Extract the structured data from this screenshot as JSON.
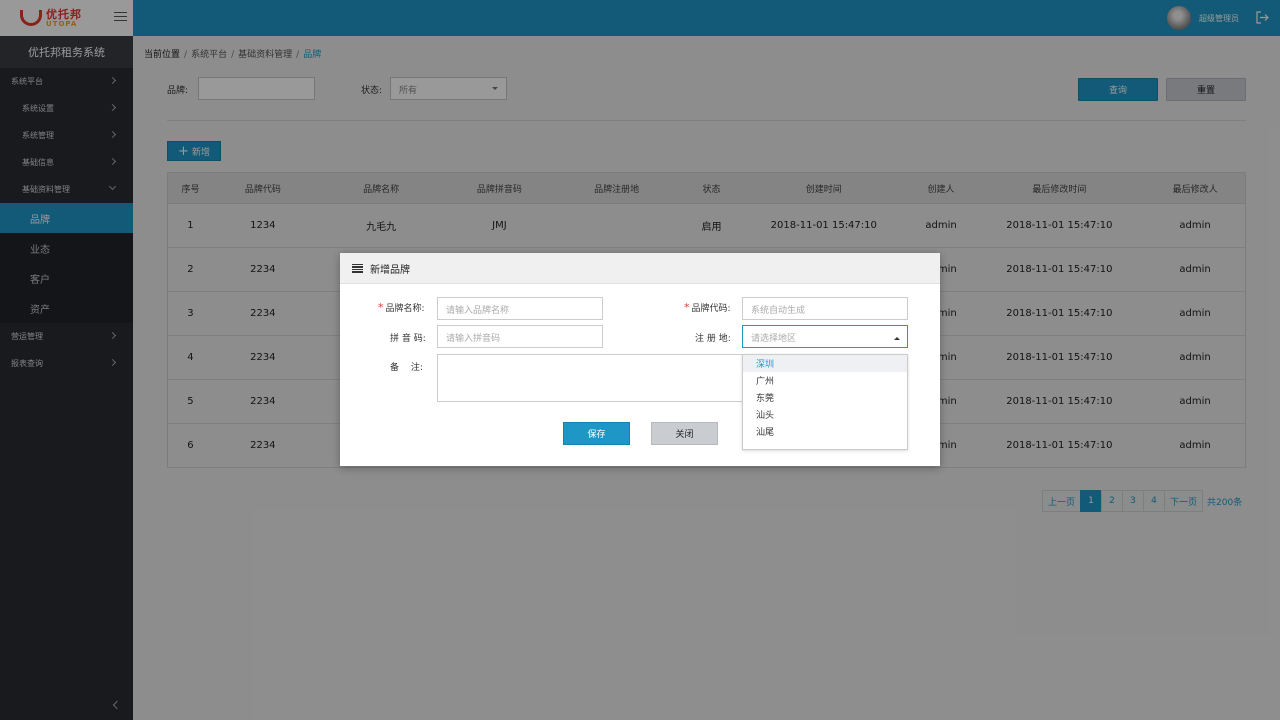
{
  "app": {
    "logo_cn": "优托邦",
    "logo_en": "UTOPA",
    "system_title": "优托邦租务系统",
    "admin_name": "超级管理员"
  },
  "sidebar": {
    "items": [
      {
        "label": "系统平台"
      },
      {
        "label": "系统设置"
      },
      {
        "label": "系统管理"
      },
      {
        "label": "基础信息"
      },
      {
        "label": "基础资料管理"
      },
      {
        "label": "品牌"
      },
      {
        "label": "业态"
      },
      {
        "label": "客户"
      },
      {
        "label": "资产"
      },
      {
        "label": "营运管理"
      },
      {
        "label": "报表查询"
      }
    ]
  },
  "breadcrumb": {
    "label": "当前位置",
    "items": [
      "系统平台",
      "基础资料管理",
      "品牌"
    ]
  },
  "filters": {
    "brand_label": "品牌:",
    "brand_value": "",
    "status_label": "状态:",
    "status_value": "所有",
    "query_button": "查询",
    "reset_button": "重置"
  },
  "toolbar": {
    "add_label": "新增"
  },
  "table": {
    "headers": [
      "序号",
      "品牌代码",
      "品牌名称",
      "品牌拼音码",
      "品牌注册地",
      "状态",
      "创建时间",
      "创建人",
      "最后修改时间",
      "最后修改人"
    ],
    "rows": [
      [
        "1",
        "1234",
        "九毛九",
        "JMJ",
        "",
        "启用",
        "2018-11-01 15:47:10",
        "admin",
        "2018-11-01 15:47:10",
        "admin"
      ],
      [
        "2",
        "2234",
        "",
        "",
        "",
        "",
        "",
        "admin",
        "2018-11-01 15:47:10",
        "admin"
      ],
      [
        "3",
        "2234",
        "",
        "",
        "",
        "",
        "",
        "admin",
        "2018-11-01 15:47:10",
        "admin"
      ],
      [
        "4",
        "2234",
        "",
        "",
        "",
        "",
        "",
        "admin",
        "2018-11-01 15:47:10",
        "admin"
      ],
      [
        "5",
        "2234",
        "",
        "",
        "",
        "",
        "",
        "admin",
        "2018-11-01 15:47:10",
        "admin"
      ],
      [
        "6",
        "2234",
        "",
        "",
        "",
        "",
        "",
        "admin",
        "2018-11-01 15:47:10",
        "admin"
      ]
    ]
  },
  "pagination": {
    "prev": "上一页",
    "pages": [
      "1",
      "2",
      "3",
      "4"
    ],
    "current": "1",
    "next": "下一页",
    "total": "共200条"
  },
  "modal": {
    "title": "新增品牌",
    "name_label": "品牌名称:",
    "name_placeholder": "请输入品牌名称",
    "code_label": "品牌代码:",
    "code_placeholder": "系统自动生成",
    "pinyin_label": "拼 音 码:",
    "pinyin_placeholder": "请输入拼音码",
    "region_label": "注 册 地:",
    "region_placeholder": "请选择地区",
    "remark_label": "备　 注:",
    "save_button": "保存",
    "close_button": "关闭",
    "region_options": [
      "深圳",
      "广州",
      "东莞",
      "汕头",
      "汕尾"
    ]
  },
  "colors": {
    "accent": "#1f97c6",
    "sidebar_bg": "#2a2c31",
    "required": "#e53935"
  }
}
